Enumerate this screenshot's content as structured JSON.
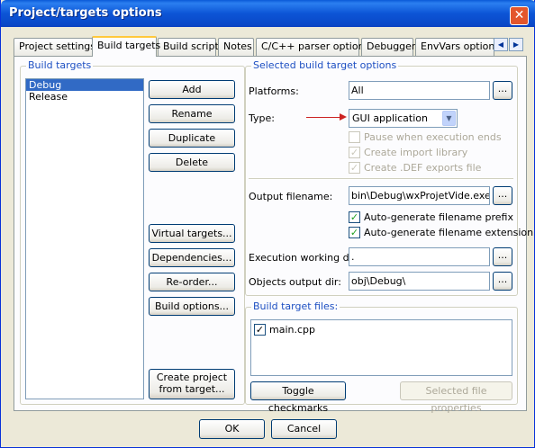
{
  "window": {
    "title": "Project/targets options",
    "close_glyph": "✕"
  },
  "tabs": [
    {
      "label": "Project settings"
    },
    {
      "label": "Build targets",
      "active": true
    },
    {
      "label": "Build scripts"
    },
    {
      "label": "Notes"
    },
    {
      "label": "C/C++ parser options"
    },
    {
      "label": "Debugger"
    },
    {
      "label": "EnvVars options"
    }
  ],
  "tab_scroll": {
    "left": "◀",
    "right": "▶"
  },
  "build_targets": {
    "group_title": "Build targets",
    "items": [
      "Debug",
      "Release"
    ],
    "selected": "Debug",
    "buttons": {
      "add": "Add",
      "rename": "Rename",
      "duplicate": "Duplicate",
      "delete": "Delete",
      "virtual_targets": "Virtual targets...",
      "dependencies": "Dependencies...",
      "reorder": "Re-order...",
      "build_options": "Build options...",
      "create_project_line1": "Create project",
      "create_project_line2": "from target..."
    }
  },
  "selected_options": {
    "group_title": "Selected build target options",
    "platforms_label": "Platforms:",
    "platforms_value": "All",
    "type_label": "Type:",
    "type_value": "GUI application",
    "pause_when_ends": {
      "label": "Pause when execution ends",
      "checked": false,
      "enabled": false
    },
    "create_import_lib": {
      "label": "Create import library",
      "checked": true,
      "enabled": false
    },
    "create_def_exports": {
      "label": "Create .DEF exports file",
      "checked": true,
      "enabled": false
    },
    "output_filename_label": "Output filename:",
    "output_filename_value": "bin\\Debug\\wxProjetVide.exe",
    "auto_prefix": {
      "label": "Auto-generate filename prefix",
      "checked": true
    },
    "auto_extension": {
      "label": "Auto-generate filename extension",
      "checked": true
    },
    "exec_dir_label": "Execution working dir:",
    "exec_dir_value": ".",
    "objects_dir_label": "Objects output dir:",
    "objects_dir_value": "obj\\Debug\\",
    "dots": "..."
  },
  "target_files": {
    "group_title": "Build target files:",
    "files": [
      {
        "name": "main.cpp",
        "checked": true
      }
    ],
    "toggle_label": "Toggle checkmarks",
    "properties_label": "Selected file properties"
  },
  "footer": {
    "ok": "OK",
    "cancel": "Cancel"
  },
  "colors": {
    "title_bar": "#0a5ad8",
    "group_title": "#1d4fc2",
    "selection": "#316ac5",
    "annotation_arrow": "#cc2222"
  }
}
